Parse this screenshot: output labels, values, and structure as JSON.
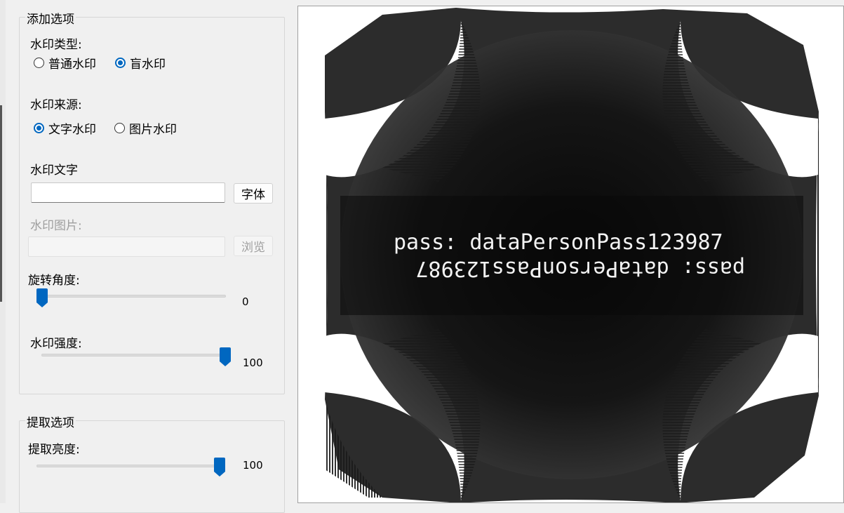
{
  "add_options": {
    "title": "添加选项",
    "watermark_type": {
      "label": "水印类型:",
      "options": [
        "普通水印",
        "盲水印"
      ],
      "selected": "盲水印"
    },
    "watermark_source": {
      "label": "水印来源:",
      "options": [
        "文字水印",
        "图片水印"
      ],
      "selected": "文字水印"
    },
    "watermark_text": {
      "label": "水印文字",
      "value": "",
      "font_button": "字体"
    },
    "watermark_image": {
      "label": "水印图片:",
      "value": "",
      "browse_button": "浏览"
    },
    "rotation": {
      "label": "旋转角度:",
      "value": "0",
      "level": 0
    },
    "strength": {
      "label": "水印强度:",
      "value": "100",
      "level": 1.0
    }
  },
  "extract_options": {
    "title": "提取选项",
    "brightness": {
      "label": "提取亮度:",
      "value": "100",
      "level": 1.0
    }
  },
  "preview": {
    "text_line": "pass: dataPersonPass123987",
    "text_line_mirrored": "pass: dataPersonPass123987"
  },
  "colors": {
    "accent": "#0067c0",
    "preview_bg": "#000000"
  }
}
